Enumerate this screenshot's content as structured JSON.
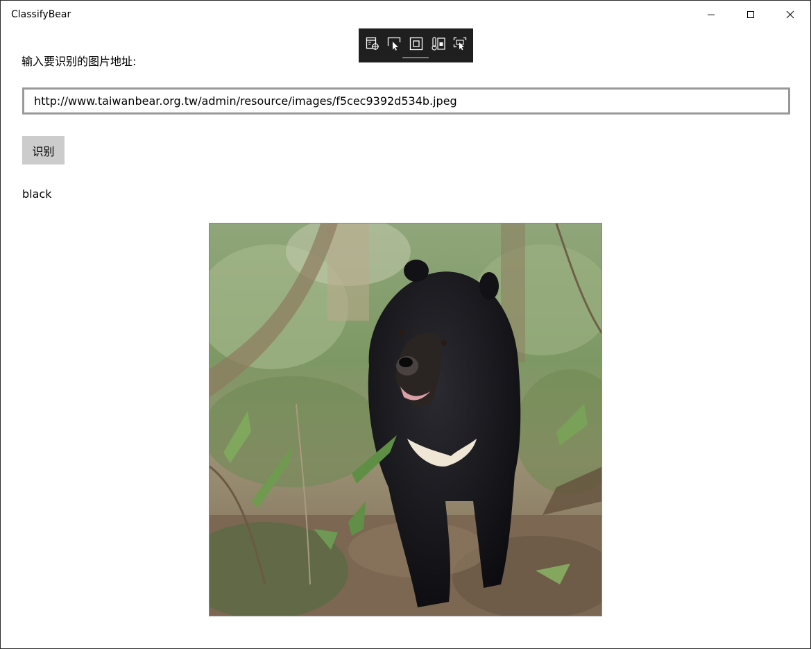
{
  "window": {
    "title": "ClassifyBear"
  },
  "window_controls": {
    "minimize_icon": "minimize-icon",
    "maximize_icon": "maximize-icon",
    "close_icon": "close-icon"
  },
  "dev_toolbar": {
    "tools": [
      "live-visual-tree-icon",
      "select-element-icon",
      "display-adorners-icon",
      "track-focus-icon",
      "preview-selection-icon"
    ]
  },
  "main": {
    "prompt_label": "输入要识别的图片地址:",
    "url_value": "http://www.taiwanbear.org.tw/admin/resource/images/f5cec9392d534b.jpeg",
    "identify_button": "识别",
    "result": "black"
  },
  "colors": {
    "input_border": "#999999",
    "button_bg": "#cccccc",
    "toolbar_bg": "#1f1f1f"
  }
}
